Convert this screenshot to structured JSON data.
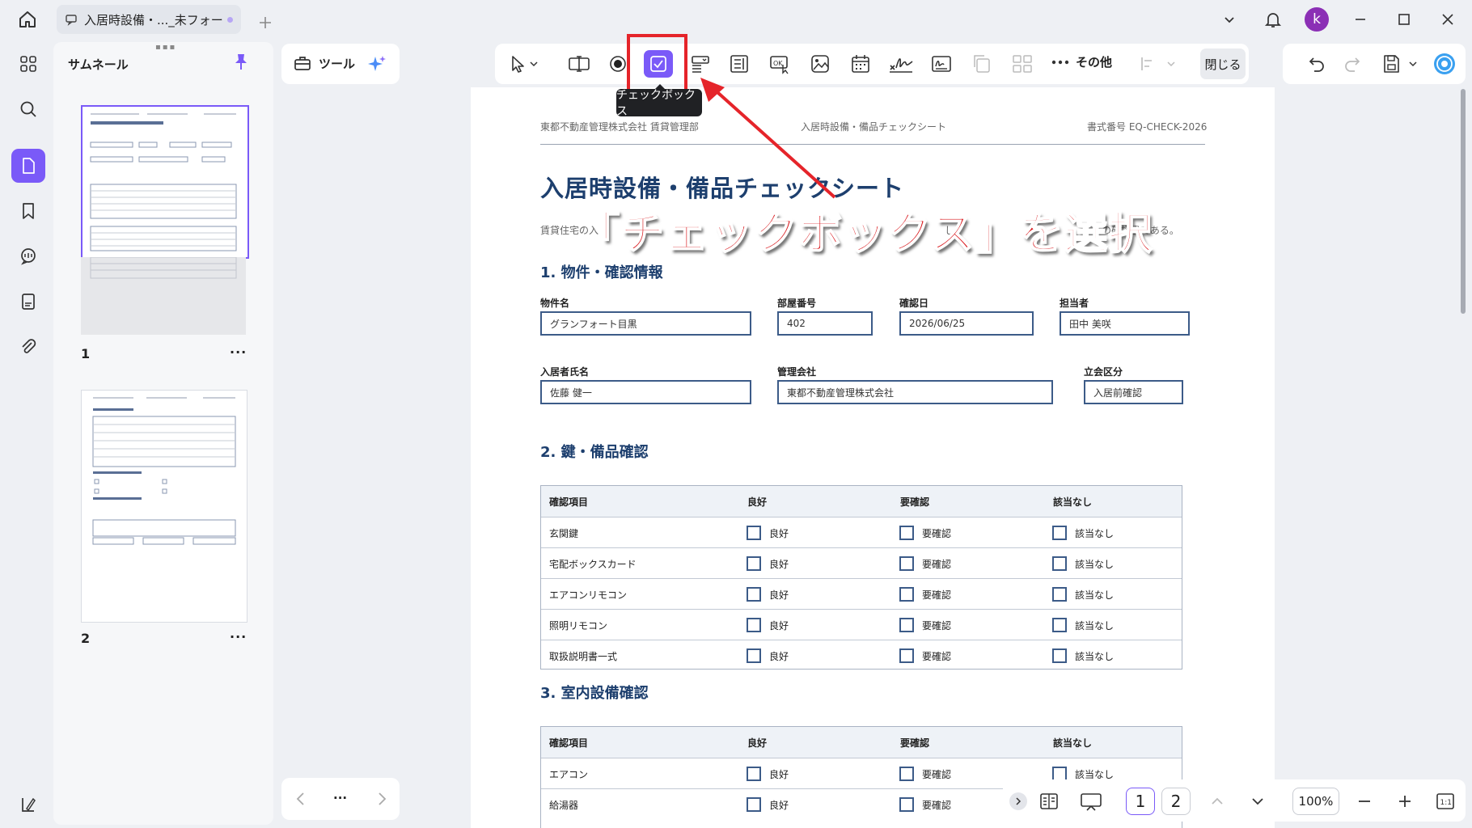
{
  "tab": {
    "title": "入居時設備・..._未フォーム"
  },
  "user": {
    "avatar_letter": "k"
  },
  "sidebar": {
    "title": "サムネール",
    "pages": [
      "1",
      "2"
    ],
    "more": "···"
  },
  "toolbar": {
    "tools_label": "ツール",
    "checkbox_tooltip": "チェックボックス",
    "more_label": "その他",
    "close_label": "閉じる"
  },
  "annotation": {
    "callout": "「チェックボックス」を選択"
  },
  "document": {
    "header_left": "東都不動産管理株式会社 賃貸管理部",
    "header_center": "入居時設備・備品チェックシート",
    "header_right": "書式番号 EQ-CHECK-2026",
    "title": "入居時設備・備品チェックシート",
    "desc_start": "賃貸住宅の入",
    "desc_mid": "し",
    "desc_end": "ための確認書である。",
    "section1": "1. 物件・確認情報",
    "fields": [
      {
        "label": "物件名",
        "value": "グランフォート目黒"
      },
      {
        "label": "部屋番号",
        "value": "402"
      },
      {
        "label": "確認日",
        "value": "2026/06/25"
      },
      {
        "label": "担当者",
        "value": "田中 美咲"
      },
      {
        "label": "入居者氏名",
        "value": "佐藤 健一"
      },
      {
        "label": "管理会社",
        "value": "東都不動産管理株式会社"
      },
      {
        "label": "立会区分",
        "value": "入居前確認"
      }
    ],
    "section2": "2. 鍵・備品確認",
    "section3": "3. 室内設備確認",
    "table_headers": [
      "確認項目",
      "良好",
      "要確認",
      "該当なし"
    ],
    "table2_rows": [
      "玄関鍵",
      "宅配ボックスカード",
      "エアコンリモコン",
      "照明リモコン",
      "取扱説明書一式"
    ],
    "table3_rows": [
      "エアコン",
      "給湯器"
    ],
    "opt_good": "良好",
    "opt_check": "要確認",
    "opt_na": "該当なし"
  },
  "pager": {
    "ellipsis": "···",
    "page1": "1",
    "page2": "2",
    "zoom": "100%"
  }
}
